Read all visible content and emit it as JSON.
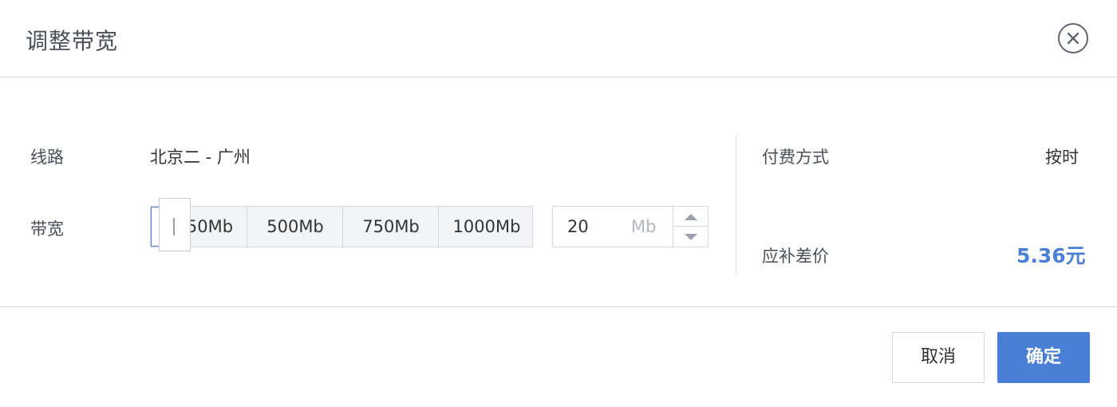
{
  "dialog": {
    "title": "调整带宽"
  },
  "form": {
    "line_label": "线路",
    "line_value": "北京二 - 广州",
    "bandwidth_label": "带宽",
    "slider_marks": [
      "250Mb",
      "500Mb",
      "750Mb",
      "1000Mb"
    ],
    "slider_visible_first": "50Mb",
    "slider_level_fraction": 0.02,
    "bandwidth_value": "20",
    "bandwidth_unit": "Mb"
  },
  "summary": {
    "payment_label": "付费方式",
    "payment_value": "按时",
    "diff_label": "应补差价",
    "diff_value": "5.36元"
  },
  "footer": {
    "cancel_label": "取消",
    "ok_label": "确定"
  },
  "icons": {
    "close": "close-circle-icon",
    "up": "chevron-up-icon",
    "down": "chevron-down-icon"
  },
  "colors": {
    "accent": "#4a7fd6",
    "border": "#d5d8e0"
  }
}
